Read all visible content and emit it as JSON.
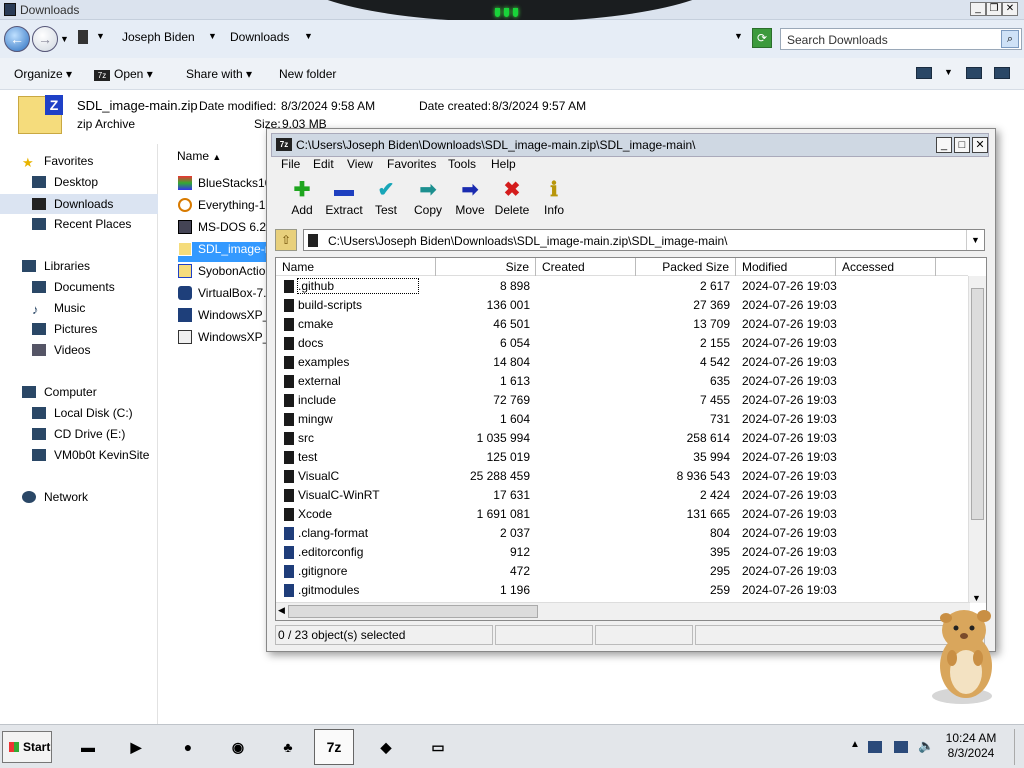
{
  "explorer": {
    "title": "Downloads",
    "breadcrumb": [
      "Joseph Biden",
      "Downloads"
    ],
    "search_placeholder": "Search Downloads",
    "toolbar": {
      "organize": "Organize",
      "open": "Open",
      "share_with": "Share with",
      "new_folder": "New folder"
    },
    "details": {
      "file_name": "SDL_image-main.zip",
      "date_modified_label": "Date modified:",
      "date_modified": "8/3/2024 9:58 AM",
      "date_created_label": "Date created:",
      "date_created": "8/3/2024 9:57 AM",
      "type": "zip Archive",
      "size_label": "Size:",
      "size": "9.03 MB"
    },
    "nav": {
      "favorites": "Favorites",
      "desktop": "Desktop",
      "downloads": "Downloads",
      "recent_places": "Recent Places",
      "libraries": "Libraries",
      "documents": "Documents",
      "music": "Music",
      "pictures": "Pictures",
      "videos": "Videos",
      "computer": "Computer",
      "local_disk": "Local Disk (C:)",
      "cd_drive": "CD Drive (E:)",
      "network_share": "VM0b0t KevinSite",
      "network": "Network"
    },
    "file_list": {
      "header": "Name",
      "items": [
        "BlueStacks10",
        "Everything-1",
        "MS-DOS 6.22",
        "SDL_image-r",
        "SyobonActio",
        "VirtualBox-7.",
        "WindowsXP_",
        "WindowsXP_"
      ]
    }
  },
  "sevenzip": {
    "title": "C:\\Users\\Joseph Biden\\Downloads\\SDL_image-main.zip\\SDL_image-main\\",
    "logo": "7z",
    "menu": [
      "File",
      "Edit",
      "View",
      "Favorites",
      "Tools",
      "Help"
    ],
    "tools": [
      {
        "label": "Add",
        "icon": "plus-icon",
        "glyph": "✚",
        "color": "#1ea51e"
      },
      {
        "label": "Extract",
        "icon": "minus-icon",
        "glyph": "▬",
        "color": "#1e3fbf"
      },
      {
        "label": "Test",
        "icon": "check-icon",
        "glyph": "✔",
        "color": "#18a6b8"
      },
      {
        "label": "Copy",
        "icon": "copy-arrow-icon",
        "glyph": "➡",
        "color": "#1c8f8f"
      },
      {
        "label": "Move",
        "icon": "move-arrow-icon",
        "glyph": "➡",
        "color": "#1a2bb0"
      },
      {
        "label": "Delete",
        "icon": "delete-x-icon",
        "glyph": "✖",
        "color": "#d41c1c"
      },
      {
        "label": "Info",
        "icon": "info-icon",
        "glyph": "ℹ",
        "color": "#b8960a"
      }
    ],
    "path": "C:\\Users\\Joseph Biden\\Downloads\\SDL_image-main.zip\\SDL_image-main\\",
    "columns": [
      "Name",
      "Size",
      "Created",
      "Packed Size",
      "Modified",
      "Accessed"
    ],
    "rows": [
      {
        "name": ".github",
        "size": "8 898",
        "packed": "2 617",
        "modified": "2024-07-26 19:03",
        "type": "folder"
      },
      {
        "name": "build-scripts",
        "size": "136 001",
        "packed": "27 369",
        "modified": "2024-07-26 19:03",
        "type": "folder"
      },
      {
        "name": "cmake",
        "size": "46 501",
        "packed": "13 709",
        "modified": "2024-07-26 19:03",
        "type": "folder"
      },
      {
        "name": "docs",
        "size": "6 054",
        "packed": "2 155",
        "modified": "2024-07-26 19:03",
        "type": "folder"
      },
      {
        "name": "examples",
        "size": "14 804",
        "packed": "4 542",
        "modified": "2024-07-26 19:03",
        "type": "folder"
      },
      {
        "name": "external",
        "size": "1 613",
        "packed": "635",
        "modified": "2024-07-26 19:03",
        "type": "folder"
      },
      {
        "name": "include",
        "size": "72 769",
        "packed": "7 455",
        "modified": "2024-07-26 19:03",
        "type": "folder"
      },
      {
        "name": "mingw",
        "size": "1 604",
        "packed": "731",
        "modified": "2024-07-26 19:03",
        "type": "folder"
      },
      {
        "name": "src",
        "size": "1 035 994",
        "packed": "258 614",
        "modified": "2024-07-26 19:03",
        "type": "folder"
      },
      {
        "name": "test",
        "size": "125 019",
        "packed": "35 994",
        "modified": "2024-07-26 19:03",
        "type": "folder"
      },
      {
        "name": "VisualC",
        "size": "25 288 459",
        "packed": "8 936 543",
        "modified": "2024-07-26 19:03",
        "type": "folder"
      },
      {
        "name": "VisualC-WinRT",
        "size": "17 631",
        "packed": "2 424",
        "modified": "2024-07-26 19:03",
        "type": "folder"
      },
      {
        "name": "Xcode",
        "size": "1 691 081",
        "packed": "131 665",
        "modified": "2024-07-26 19:03",
        "type": "folder"
      },
      {
        "name": ".clang-format",
        "size": "2 037",
        "packed": "804",
        "modified": "2024-07-26 19:03",
        "type": "file"
      },
      {
        "name": ".editorconfig",
        "size": "912",
        "packed": "395",
        "modified": "2024-07-26 19:03",
        "type": "file"
      },
      {
        "name": ".gitignore",
        "size": "472",
        "packed": "295",
        "modified": "2024-07-26 19:03",
        "type": "file"
      },
      {
        "name": ".gitmodules",
        "size": "1 196",
        "packed": "259",
        "modified": "2024-07-26 19:03",
        "type": "file"
      }
    ],
    "status": "0 / 23 object(s) selected"
  },
  "taskbar": {
    "start": "Start",
    "apps": [
      {
        "name": "terminal-app",
        "glyph": "▬"
      },
      {
        "name": "media-player-app",
        "glyph": "▶"
      },
      {
        "name": "globe-app",
        "glyph": "●"
      },
      {
        "name": "firefox-app",
        "glyph": "◉"
      },
      {
        "name": "people-app",
        "glyph": "♣"
      },
      {
        "name": "7zip-app",
        "glyph": "7z"
      },
      {
        "name": "virtualbox-app",
        "glyph": "◆"
      },
      {
        "name": "display-app",
        "glyph": "▭"
      }
    ],
    "time": "10:24 AM",
    "date": "8/3/2024"
  }
}
